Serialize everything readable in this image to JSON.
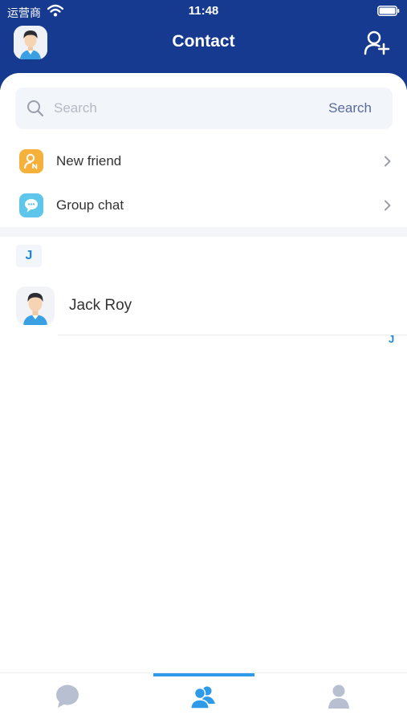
{
  "status_bar": {
    "carrier": "运营商",
    "time": "11:48"
  },
  "nav": {
    "title": "Contact"
  },
  "search": {
    "placeholder": "Search",
    "button_label": "Search"
  },
  "menu": [
    {
      "label": "New friend",
      "icon": "new-friend-icon",
      "color": "#f6b13b"
    },
    {
      "label": "Group chat",
      "icon": "group-chat-icon",
      "color": "#5ec6ea"
    }
  ],
  "contacts": {
    "section_letter": "J",
    "items": [
      {
        "name": "Jack Roy"
      }
    ],
    "alphabet_index": [
      "J"
    ]
  },
  "tab_bar": {
    "tabs": [
      {
        "icon": "chat-icon",
        "active": false
      },
      {
        "icon": "contacts-icon",
        "active": true
      },
      {
        "icon": "profile-icon",
        "active": false
      }
    ]
  },
  "colors": {
    "header": "#163a8f",
    "accent": "#2d9bea",
    "inactive_tab": "#b8bfd0"
  }
}
